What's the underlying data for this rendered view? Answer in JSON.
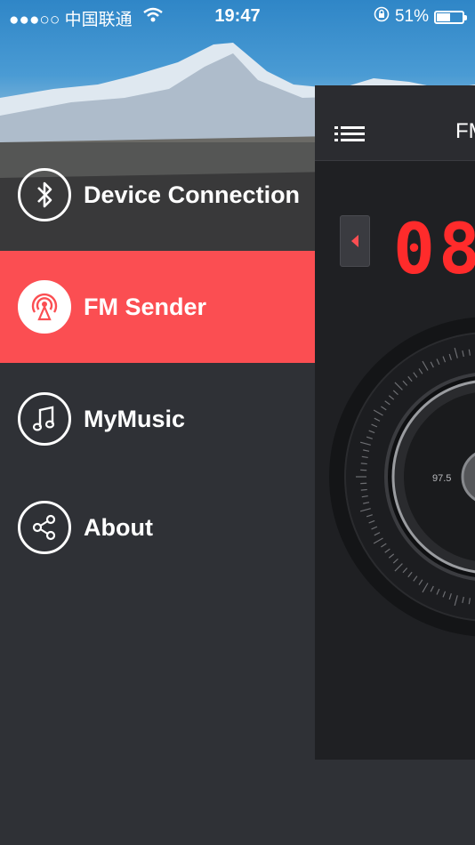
{
  "status": {
    "carrier": "●●●○○ 中国联通",
    "time": "19:47",
    "battery": "51%"
  },
  "menu": {
    "items": [
      {
        "label": "Device Connection"
      },
      {
        "label": "FM Sender"
      },
      {
        "label": "MyMusic"
      },
      {
        "label": "About"
      }
    ]
  },
  "main": {
    "title": "FM",
    "frequency": "08",
    "dial_label": "97.5"
  },
  "colors": {
    "accent": "#fb4e52",
    "display": "#ff2b2b",
    "sidebar": "#2f3136"
  }
}
